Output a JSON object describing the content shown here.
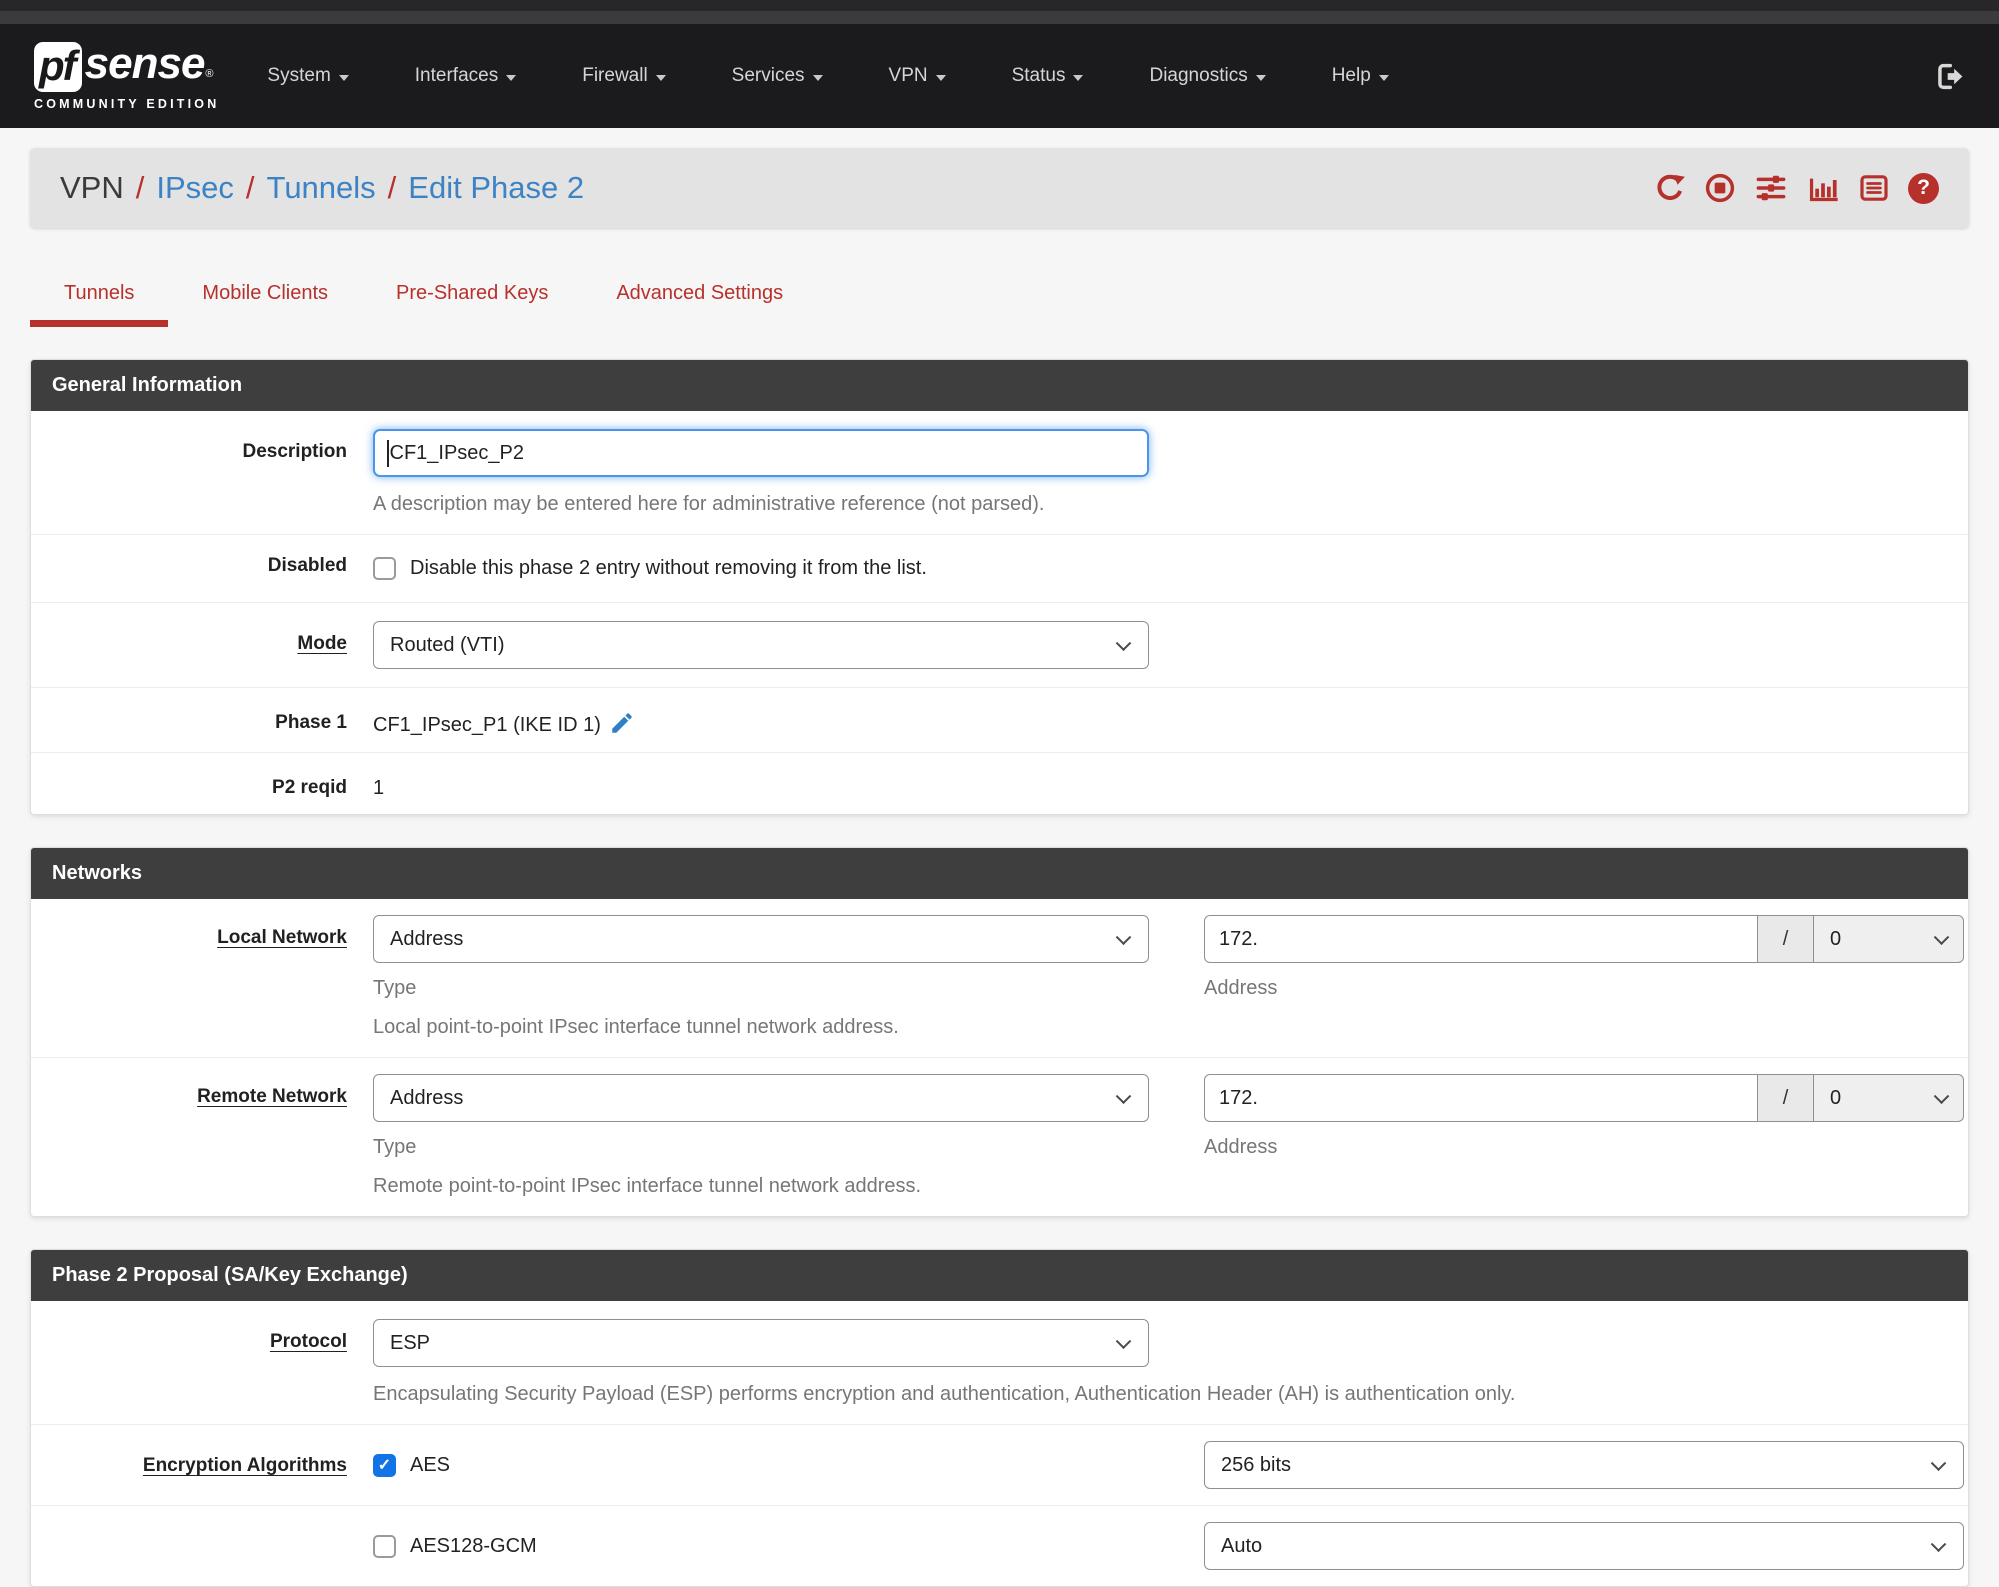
{
  "colors": {
    "accent_red": "#b7312c",
    "link_blue": "#3d83c4",
    "checkbox_blue": "#1273e7",
    "panel_header_bg": "#3e3e3e",
    "navbar_bg": "#1b1b1d",
    "focus_blue": "#4a96e8"
  },
  "navbar": {
    "brand": {
      "pf": "pf",
      "sense": "sense",
      "registered": "®",
      "tagline": "COMMUNITY EDITION"
    },
    "items": [
      {
        "label": "System"
      },
      {
        "label": "Interfaces"
      },
      {
        "label": "Firewall"
      },
      {
        "label": "Services"
      },
      {
        "label": "VPN"
      },
      {
        "label": "Status"
      },
      {
        "label": "Diagnostics"
      },
      {
        "label": "Help"
      }
    ],
    "logout_icon": "sign-out-icon"
  },
  "breadcrumb": {
    "separator": "/",
    "items": [
      {
        "label": "VPN"
      },
      {
        "label": "IPsec"
      },
      {
        "label": "Tunnels"
      },
      {
        "label": "Edit Phase 2"
      }
    ],
    "action_icons": [
      "refresh-icon",
      "stop-circle-icon",
      "sliders-icon",
      "bar-chart-icon",
      "list-icon",
      "help-icon"
    ]
  },
  "tabs": [
    {
      "label": "Tunnels",
      "active": true
    },
    {
      "label": "Mobile Clients",
      "active": false
    },
    {
      "label": "Pre-Shared Keys",
      "active": false
    },
    {
      "label": "Advanced Settings",
      "active": false
    }
  ],
  "general": {
    "title": "General Information",
    "description": {
      "label": "Description",
      "value": "CF1_IPsec_P2",
      "help": "A description may be entered here for administrative reference (not parsed)."
    },
    "disabled": {
      "label": "Disabled",
      "checked": false,
      "checkbox_label": "Disable this phase 2 entry without removing it from the list."
    },
    "mode": {
      "label": "Mode",
      "value": "Routed (VTI)"
    },
    "phase1": {
      "label": "Phase 1",
      "value": "CF1_IPsec_P1 (IKE ID 1)",
      "edit_icon": "pencil-icon"
    },
    "p2reqid": {
      "label": "P2 reqid",
      "value": "1"
    }
  },
  "networks": {
    "title": "Networks",
    "local": {
      "label": "Local Network",
      "type_value": "Address",
      "type_caption": "Type",
      "address_value": "172.",
      "address_caption": "Address",
      "mask_separator": "/",
      "mask_value": "0",
      "help": "Local point-to-point IPsec interface tunnel network address."
    },
    "remote": {
      "label": "Remote Network",
      "type_value": "Address",
      "type_caption": "Type",
      "address_value": "172.",
      "address_caption": "Address",
      "mask_separator": "/",
      "mask_value": "0",
      "help": "Remote point-to-point IPsec interface tunnel network address."
    }
  },
  "proposal": {
    "title": "Phase 2 Proposal (SA/Key Exchange)",
    "protocol": {
      "label": "Protocol",
      "value": "ESP",
      "help": "Encapsulating Security Payload (ESP) performs encryption and authentication, Authentication Header (AH) is authentication only."
    },
    "encryption": {
      "label": "Encryption Algorithms",
      "rows": [
        {
          "name": "AES",
          "checked": true,
          "keylen": "256 bits"
        },
        {
          "name": "AES128-GCM",
          "checked": false,
          "keylen": "Auto"
        }
      ]
    }
  }
}
